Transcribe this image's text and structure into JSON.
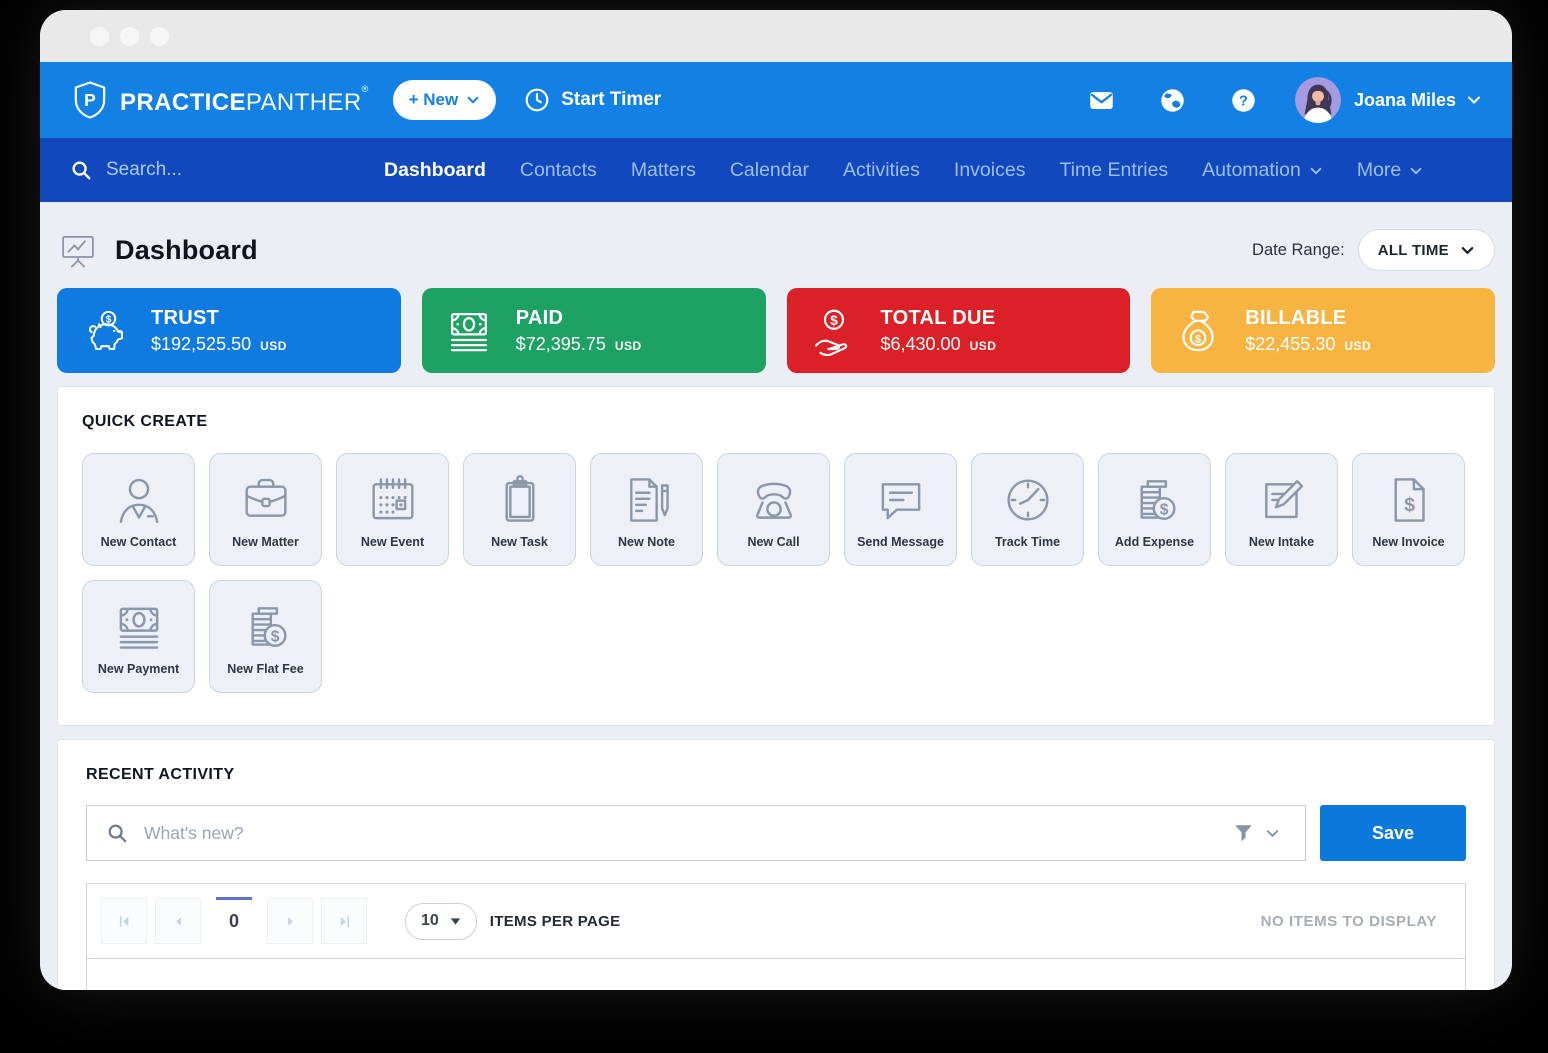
{
  "header": {
    "brand_bold": "PRACTICE",
    "brand_light": "PANTHER",
    "brand_reg": "®",
    "new_button_label": "+ New",
    "start_timer_label": "Start Timer",
    "user_name": "Joana Miles"
  },
  "nav": {
    "search_placeholder": "Search...",
    "items": [
      {
        "label": "Dashboard",
        "active": true
      },
      {
        "label": "Contacts"
      },
      {
        "label": "Matters"
      },
      {
        "label": "Calendar"
      },
      {
        "label": "Activities"
      },
      {
        "label": "Invoices"
      },
      {
        "label": "Time Entries"
      },
      {
        "label": "Automation",
        "has_dropdown": true
      },
      {
        "label": "More",
        "has_dropdown": true
      }
    ]
  },
  "page": {
    "title": "Dashboard",
    "date_range_label": "Date Range:",
    "date_range_value": "ALL TIME"
  },
  "stats": [
    {
      "label": "TRUST",
      "amount": "$192,525.50",
      "currency": "USD",
      "color": "#0F7ADF",
      "icon": "piggy-bank-icon"
    },
    {
      "label": "PAID",
      "amount": "$72,395.75",
      "currency": "USD",
      "color": "#1EA263",
      "icon": "cash-icon"
    },
    {
      "label": "TOTAL DUE",
      "amount": "$6,430.00",
      "currency": "USD",
      "color": "#DB2127",
      "icon": "hand-coin-icon"
    },
    {
      "label": "BILLABLE",
      "amount": "$22,455.30",
      "currency": "USD",
      "color": "#F7B440",
      "icon": "money-bag-icon"
    }
  ],
  "quick_create": {
    "title": "QUICK CREATE",
    "tiles": [
      {
        "label": "New Contact",
        "icon": "person-icon"
      },
      {
        "label": "New Matter",
        "icon": "briefcase-icon"
      },
      {
        "label": "New Event",
        "icon": "calendar-icon"
      },
      {
        "label": "New Task",
        "icon": "clipboard-icon"
      },
      {
        "label": "New Note",
        "icon": "note-pen-icon"
      },
      {
        "label": "New Call",
        "icon": "phone-icon"
      },
      {
        "label": "Send Message",
        "icon": "chat-bubble-icon"
      },
      {
        "label": "Track Time",
        "icon": "clock-icon"
      },
      {
        "label": "Add Expense",
        "icon": "coins-dollar-icon"
      },
      {
        "label": "New Intake",
        "icon": "doc-pencil-icon"
      },
      {
        "label": "New Invoice",
        "icon": "doc-dollar-icon"
      },
      {
        "label": "New Payment",
        "icon": "cash-icon"
      },
      {
        "label": "New Flat Fee",
        "icon": "coins-dollar-icon"
      }
    ]
  },
  "recent_activity": {
    "title": "RECENT ACTIVITY",
    "search_placeholder": "What's new?",
    "save_label": "Save",
    "pagination": {
      "current_page": "0",
      "per_page": "10",
      "items_per_page_label": "ITEMS PER PAGE",
      "empty_message": "NO ITEMS TO DISPLAY"
    }
  },
  "colors": {
    "header_blue": "#1380E4",
    "nav_blue": "#1148BE",
    "accent_blue": "#0B79DB",
    "page_background": "#EBEEF4"
  }
}
